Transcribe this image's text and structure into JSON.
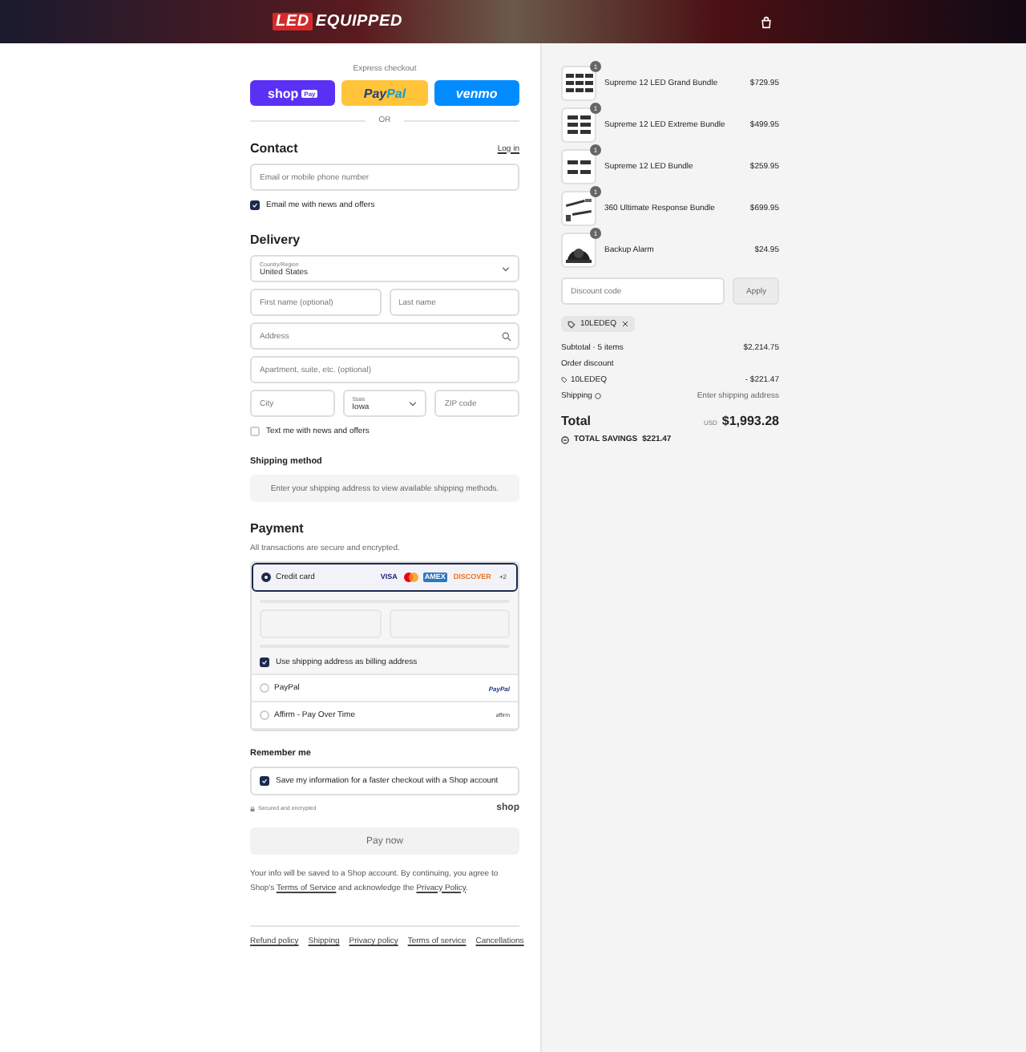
{
  "header": {
    "logo_mark": "LED",
    "logo_word": "EQUIPPED"
  },
  "express": {
    "label": "Express checkout",
    "buttons": [
      {
        "kind": "shop",
        "label": "shop",
        "badge": "Pay"
      },
      {
        "kind": "paypal",
        "label": "Pay",
        "label2": "Pal"
      },
      {
        "kind": "venmo",
        "label": "venmo"
      }
    ],
    "divider": "OR"
  },
  "contact": {
    "title": "Contact",
    "login": "Log in",
    "email_placeholder": "Email or mobile phone number",
    "news": {
      "label": "Email me with news and offers",
      "checked": true
    }
  },
  "delivery": {
    "title": "Delivery",
    "country": {
      "label": "Country/Region",
      "value": "United States"
    },
    "first_placeholder": "First name (optional)",
    "last_placeholder": "Last name",
    "address_placeholder": "Address",
    "apt_placeholder": "Apartment, suite, etc. (optional)",
    "city_placeholder": "City",
    "state": {
      "label": "State",
      "value": "Iowa"
    },
    "zip_placeholder": "ZIP code",
    "text_news": {
      "label": "Text me with news and offers",
      "checked": false
    }
  },
  "shipping_method": {
    "title": "Shipping method",
    "message": "Enter your shipping address to view available shipping methods."
  },
  "payment": {
    "title": "Payment",
    "subtitle": "All transactions are secure and encrypted.",
    "methods": [
      {
        "kind": "card",
        "label": "Credit card",
        "selected": true,
        "brands": [
          {
            "kind": "visa",
            "label": "VISA"
          },
          {
            "kind": "mastercard"
          },
          {
            "kind": "amex",
            "label": "AMEX"
          },
          {
            "kind": "discover",
            "label": "DISCOVER"
          }
        ],
        "more": "+2"
      },
      {
        "kind": "paypal",
        "label": "PayPal",
        "selected": false,
        "logo": "PayPal"
      },
      {
        "kind": "affirm",
        "label": "Affirm - Pay Over Time",
        "selected": false,
        "logo": "affirm"
      }
    ],
    "billing": {
      "label": "Use shipping address as billing address",
      "checked": true
    }
  },
  "remember": {
    "title": "Remember me",
    "save": {
      "label": "Save my information for a faster checkout with a Shop account",
      "checked": true
    },
    "secure": "Secured and encrypted",
    "shop_logo": "shop"
  },
  "pay_button": "Pay now",
  "legal": {
    "before": "Your info will be saved to a Shop account. By continuing, you agree to Shop's",
    "link1": "Terms of Service",
    "middle": "and acknowledge the",
    "link2": "Privacy Policy",
    "after": "."
  },
  "footer_links": [
    "Refund policy",
    "Shipping",
    "Privacy policy",
    "Terms of service",
    "Cancellations"
  ],
  "order": {
    "items": [
      {
        "kind": "bars3",
        "name": "Supreme 12 LED Grand Bundle",
        "price": "$729.95",
        "qty": "1"
      },
      {
        "kind": "bars2",
        "name": "Supreme 12 LED Extreme Bundle",
        "price": "$499.95",
        "qty": "1"
      },
      {
        "kind": "bars1",
        "name": "Supreme 12 LED Bundle",
        "price": "$259.95",
        "qty": "1"
      },
      {
        "kind": "kit",
        "name": "360 Ultimate Response Bundle",
        "price": "$699.95",
        "qty": "1"
      },
      {
        "kind": "alarm",
        "name": "Backup Alarm",
        "price": "$24.95",
        "qty": "1"
      }
    ],
    "discount_placeholder": "Discount code",
    "apply": "Apply",
    "applied_code": "10LEDEQ",
    "subtotal_label": "Subtotal · 5 items",
    "subtotal": "$2,214.75",
    "order_discount": "Order discount",
    "code": "10LEDEQ",
    "discount": "- $221.47",
    "shipping_label": "Shipping",
    "shipping_value": "Enter shipping address",
    "total_label": "Total",
    "currency": "USD",
    "total": "$1,993.28",
    "savings_label": "TOTAL SAVINGS",
    "savings": "$221.47"
  }
}
